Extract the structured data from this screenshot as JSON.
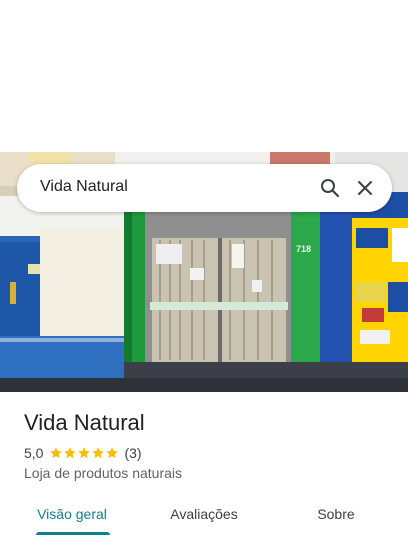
{
  "search": {
    "query": "Vida Natural"
  },
  "photo": {
    "store_number": "718",
    "sign_phone_1": "67 9.9897-0212",
    "sign_phone_2": "67 9.9897-0212",
    "right_banner": "ASSISTÊ",
    "right_panel_text_1": "MANUTENÇÃO DE COMPUTADORES E NOTEBOOKS E IMPRESSORAS",
    "right_panel_text_2": "FORMATAÇÃO DE COMPUTADORES E NOTEBOOKS",
    "right_panel_text_3": "CA"
  },
  "place": {
    "name": "Vida Natural",
    "rating": "5,0",
    "stars": 5,
    "review_count": "(3)",
    "category": "Loja de produtos naturais"
  },
  "tabs": [
    {
      "label": "Visão geral",
      "active": true
    },
    {
      "label": "Avaliações",
      "active": false
    },
    {
      "label": "Sobre",
      "active": false
    }
  ],
  "colors": {
    "accent": "#137e8b",
    "star": "#fbbc04"
  }
}
